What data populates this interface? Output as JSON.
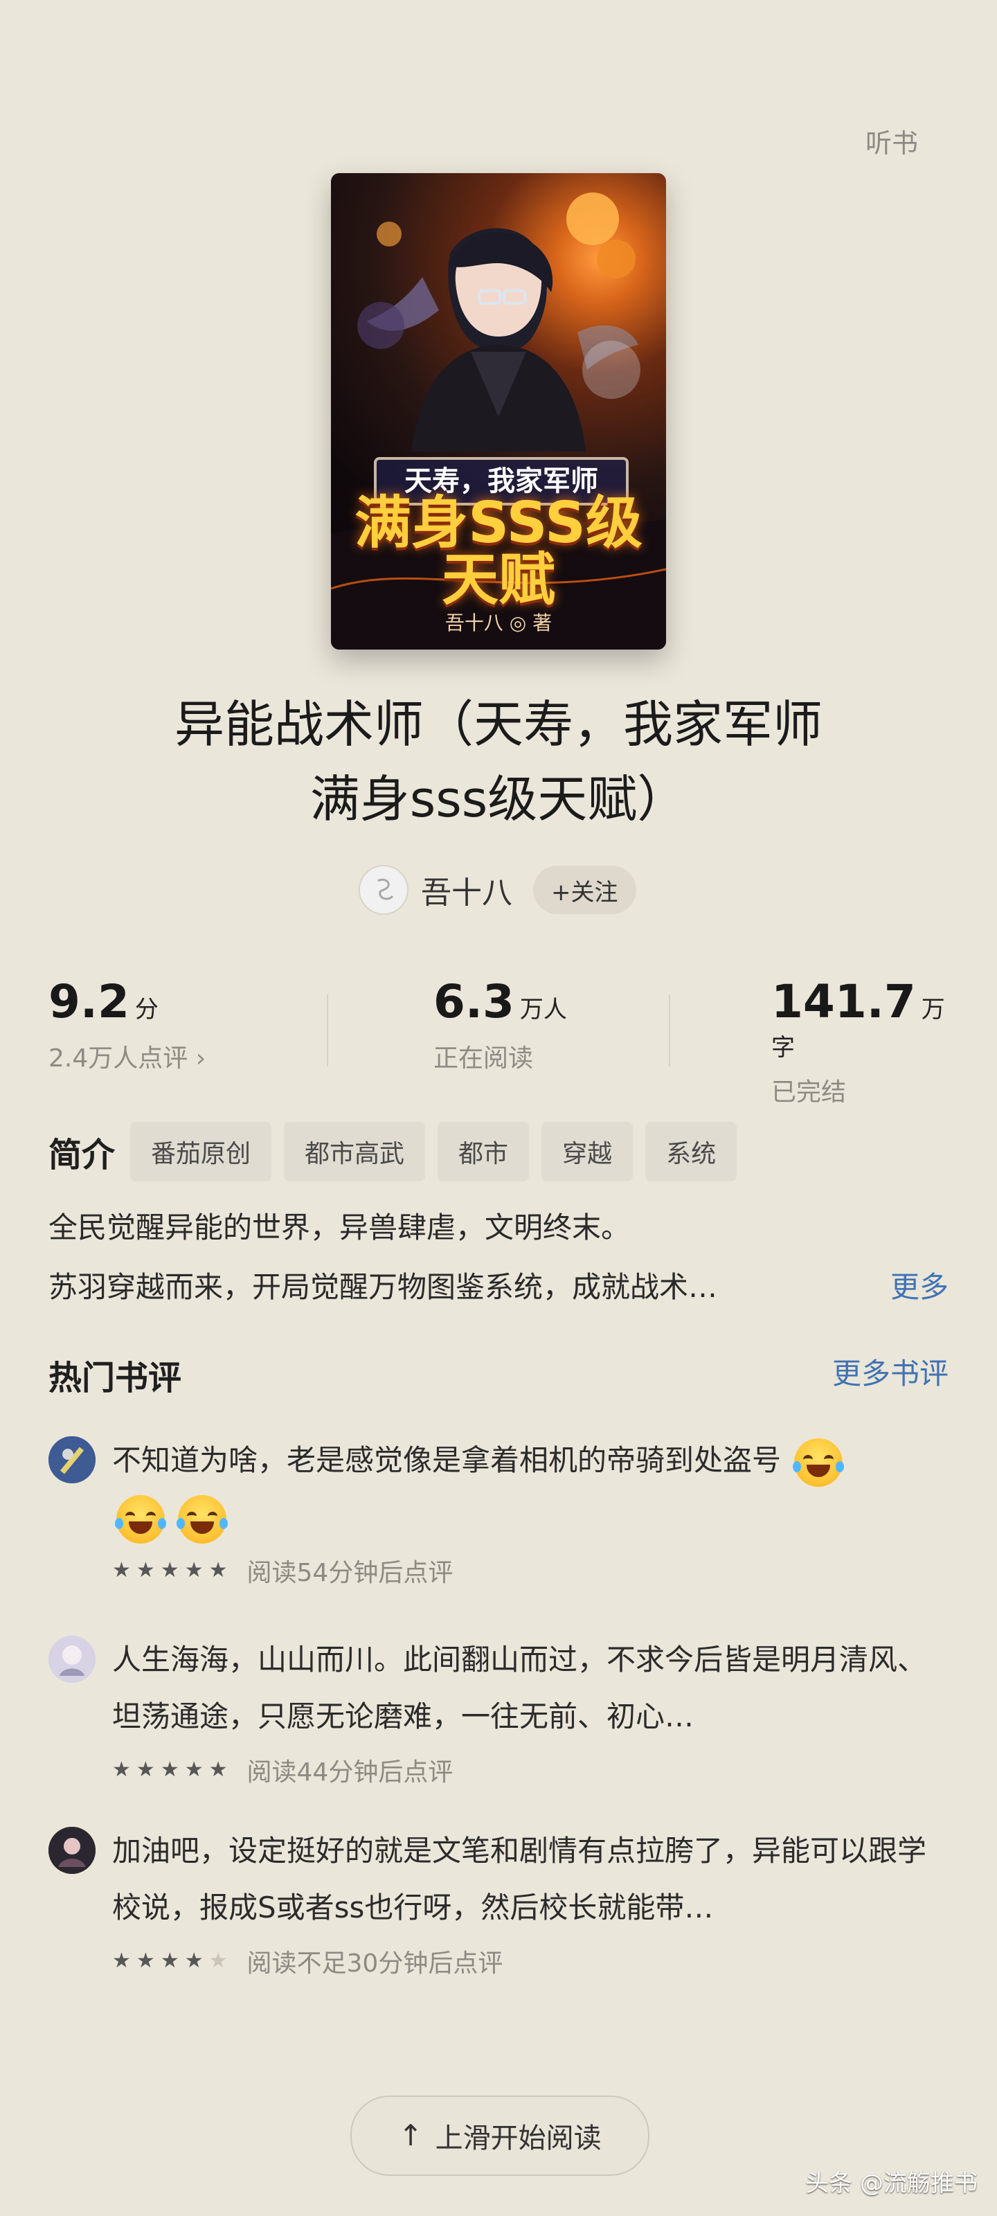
{
  "header": {
    "listen": "听书"
  },
  "cover": {
    "small_title": "天寿，我家军师",
    "big_title": "满身SSS级天赋",
    "author": "吾十八 ◎ 著"
  },
  "book": {
    "title_line1": "异能战术师（天寿，我家军师",
    "title_line2": "满身sss级天赋）"
  },
  "author": {
    "name": "吾十八",
    "follow_label": "+关注"
  },
  "stats": {
    "rating": "9.2",
    "rating_unit": "分",
    "rating_sub": "2.4万人点评 ›",
    "readers": "6.3",
    "readers_unit": "万人",
    "readers_sub": "正在阅读",
    "words": "141.7",
    "words_unit": "万字",
    "words_sub": "已完结"
  },
  "intro": {
    "label": "简介",
    "tags": [
      "番茄原创",
      "都市高武",
      "都市",
      "穿越",
      "系统"
    ],
    "line1": "全民觉醒异能的世界，异兽肆虐，文明终末。",
    "line2": "苏羽穿越而来，开局觉醒万物图鉴系统，成就战术…",
    "more": "更多"
  },
  "hot_reviews": {
    "title": "热门书评",
    "more": "更多书评",
    "items": [
      {
        "text": "不知道为啥，老是感觉像是拿着相机的帝骑到处盗号",
        "meta": "阅读54分钟后点评",
        "stars": 5,
        "avatar_color": "#3e5b94"
      },
      {
        "text": "人生海海，山山而川。此间翻山而过，不求今后皆是明月清风、坦荡通途，只愿无论磨难，一往无前、初心…",
        "meta": "阅读44分钟后点评",
        "stars": 5,
        "avatar_color": "#d7d3e5"
      },
      {
        "text": "加油吧，设定挺好的就是文笔和剧情有点拉胯了，异能可以跟学校说，报成S或者ss也行呀，然后校长就能带…",
        "meta": "阅读不足30分钟后点评",
        "stars": 4,
        "avatar_color": "#2a2730"
      }
    ]
  },
  "bottom": {
    "start_read": "上滑开始阅读"
  },
  "watermark": "头条 @流觞推书",
  "colors": {
    "background": "#ebe6da",
    "accent_link": "#3f73b4",
    "tag_bg": "#e1dcd1"
  }
}
